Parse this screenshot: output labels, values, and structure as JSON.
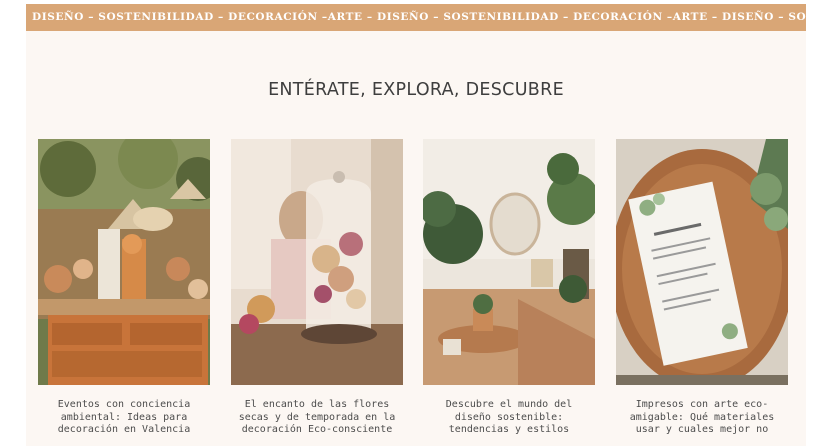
{
  "ticker": {
    "text": "DISEÑO – SOSTENIBILIDAD – DECORACIÓN –ARTE – DISEÑO – SOSTENIBILIDAD – DECORACIÓN –ARTE – DISEÑO – SOSTENIBILIDAD"
  },
  "section": {
    "title": "ENTÉRATE, EXPLORA, DESCUBRE"
  },
  "posts": [
    {
      "caption": "Eventos con conciencia ambiental: Ideas para decoración en Valencia",
      "image": "event-decor-photo"
    },
    {
      "caption": "El encanto de las flores secas y de temporada en la decoración Eco-consciente",
      "image": "dried-flowers-glass-dome-photo"
    },
    {
      "caption": "Descubre el mundo del diseño sostenible: tendencias y estilos",
      "image": "boho-plants-interior-photo"
    },
    {
      "caption": "Impresos con arte eco-amigable: Qué materiales usar y cuales mejor no",
      "image": "eco-menu-card-photo"
    }
  ]
}
